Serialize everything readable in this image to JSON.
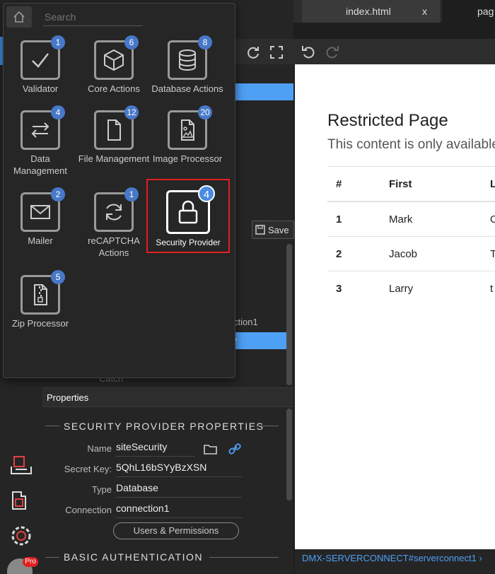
{
  "popup": {
    "search_placeholder": "Search",
    "items": [
      {
        "label": "Validator",
        "badge": "1",
        "icon": "check-icon"
      },
      {
        "label": "Core Actions",
        "badge": "6",
        "icon": "cube-icon"
      },
      {
        "label": "Database Actions",
        "badge": "8",
        "icon": "database-icon"
      },
      {
        "label": "Data Management",
        "badge": "4",
        "icon": "swap-arrows-icon"
      },
      {
        "label": "File Management",
        "badge": "12",
        "icon": "file-icon"
      },
      {
        "label": "Image Processor",
        "badge": "20",
        "icon": "image-file-icon"
      },
      {
        "label": "Mailer",
        "badge": "2",
        "icon": "mail-icon"
      },
      {
        "label": "reCAPTCHA Actions",
        "badge": "1",
        "icon": "refresh-icon"
      },
      {
        "label": "Security Provider",
        "badge": "4",
        "icon": "lock-icon"
      },
      {
        "label": "Zip Processor",
        "badge": "5",
        "icon": "zip-file-icon"
      }
    ]
  },
  "tabs": {
    "active": "index.html",
    "close": "x",
    "second": "pag"
  },
  "middle": {
    "save_label": "Save",
    "tree_connection": "ction1",
    "tree_selected": "y",
    "tree_catch": "Catch"
  },
  "properties": {
    "panel_title": "Properties",
    "section_title": "SECURITY PROVIDER PROPERTIES",
    "name_label": "Name",
    "name_value": "siteSecurity",
    "secret_label": "Secret Key:",
    "secret_value": "5QhL16bSYyBzXSN",
    "type_label": "Type",
    "type_value": "Database",
    "connection_label": "Connection",
    "connection_value": "connection1",
    "users_button": "Users & Permissions",
    "section2_title": "BASIC AUTHENTICATION"
  },
  "preview": {
    "title": "Restricted Page",
    "lead": "This content is only available",
    "headers": [
      "#",
      "First",
      "L"
    ],
    "rows": [
      [
        "1",
        "Mark",
        "O"
      ],
      [
        "2",
        "Jacob",
        "T"
      ],
      [
        "3",
        "Larry",
        "t"
      ]
    ]
  },
  "status_text": "DMX-SERVERCONNECT#serverconnect1 ›",
  "pro_badge": "Pro",
  "colors": {
    "accent": "#4ea0f5",
    "badge": "#4878c8",
    "highlight": "#e02020"
  }
}
